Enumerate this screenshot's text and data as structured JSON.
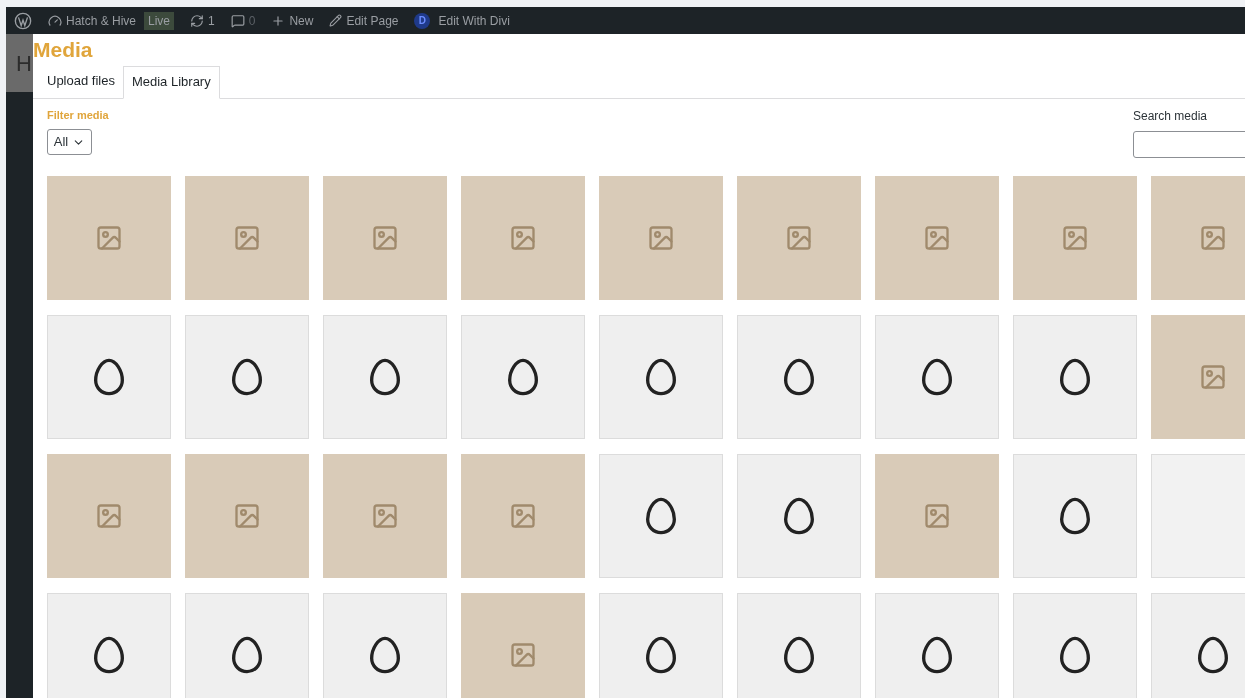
{
  "admin_bar": {
    "site": "Hatch & Hive",
    "badge": "Live",
    "updates": "1",
    "comments": "0",
    "new": "New",
    "edit": "Edit Page",
    "divi_letter": "D",
    "divi": "Edit With Divi"
  },
  "background_heading": "H",
  "modal": {
    "title": "Media",
    "tabs": [
      {
        "label": "Upload files",
        "selected": false
      },
      {
        "label": "Media Library",
        "selected": true
      }
    ],
    "filter": {
      "label": "Filter media",
      "value": "All"
    },
    "search": {
      "label": "Search media"
    },
    "thumbnails": [
      {
        "kind": "photo"
      },
      {
        "kind": "photo"
      },
      {
        "kind": "photo"
      },
      {
        "kind": "photo"
      },
      {
        "kind": "photo"
      },
      {
        "kind": "photo"
      },
      {
        "kind": "photo"
      },
      {
        "kind": "photo"
      },
      {
        "kind": "photo"
      },
      {
        "kind": "illustration"
      },
      {
        "kind": "illustration"
      },
      {
        "kind": "illustration"
      },
      {
        "kind": "illustration"
      },
      {
        "kind": "illustration"
      },
      {
        "kind": "illustration"
      },
      {
        "kind": "illustration"
      },
      {
        "kind": "illustration"
      },
      {
        "kind": "photo"
      },
      {
        "kind": "photo"
      },
      {
        "kind": "photo"
      },
      {
        "kind": "photo"
      },
      {
        "kind": "photo"
      },
      {
        "kind": "illustration"
      },
      {
        "kind": "illustration"
      },
      {
        "kind": "photo"
      },
      {
        "kind": "illustration"
      },
      {
        "kind": "blank"
      },
      {
        "kind": "illustration"
      },
      {
        "kind": "illustration"
      },
      {
        "kind": "illustration"
      },
      {
        "kind": "photo"
      },
      {
        "kind": "illustration"
      },
      {
        "kind": "illustration"
      },
      {
        "kind": "illustration"
      },
      {
        "kind": "illustration"
      },
      {
        "kind": "illustration"
      }
    ]
  }
}
